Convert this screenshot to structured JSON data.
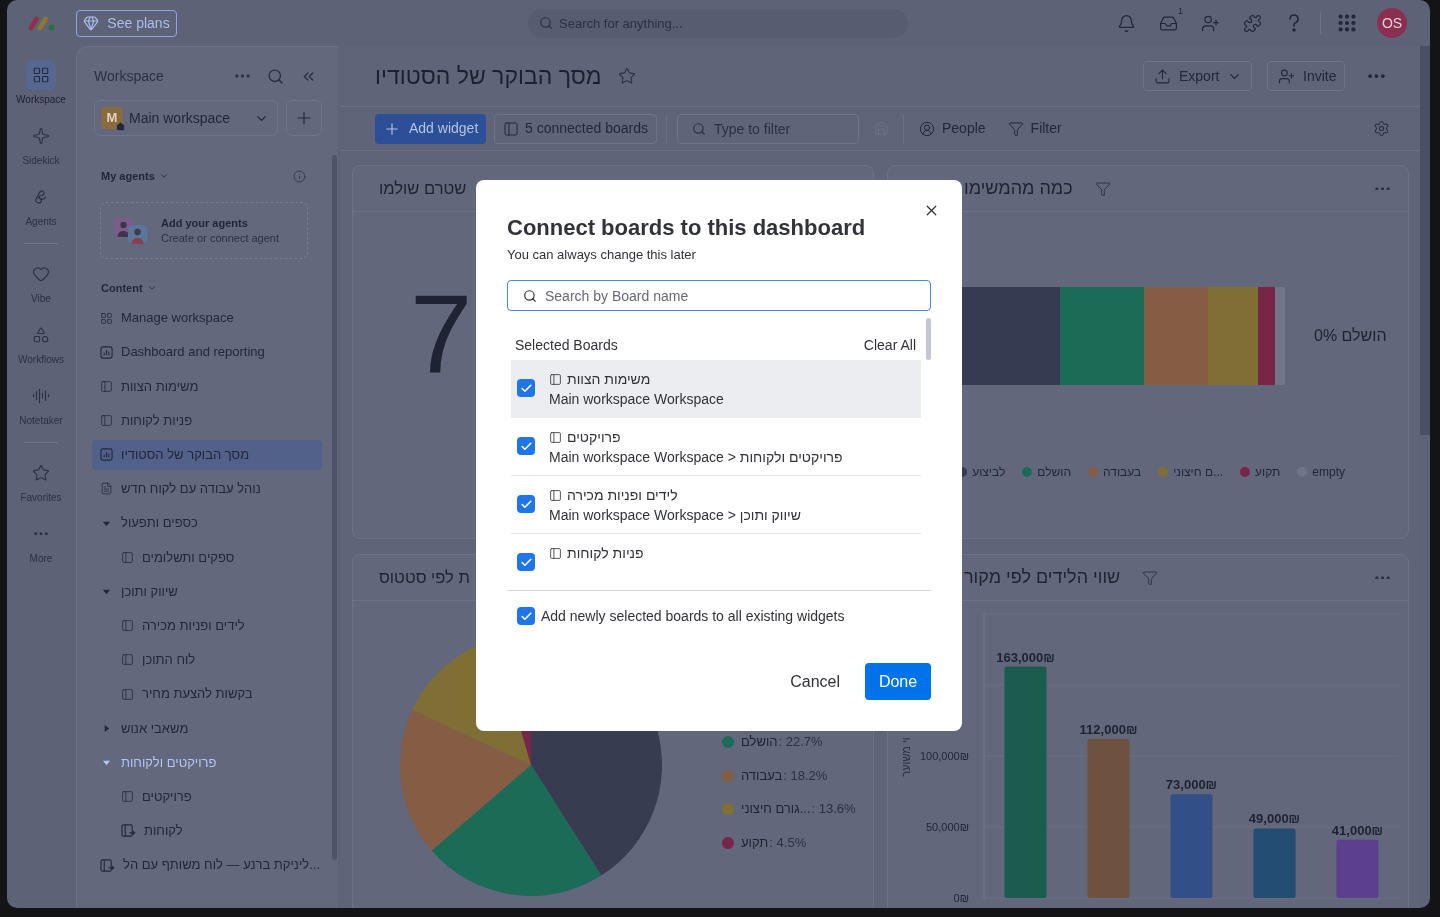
{
  "top_bar": {
    "upgrade": "See plans",
    "search": {
      "placeholder": "Search for anything..."
    },
    "inbox_badge": "1",
    "avatar": "OS"
  },
  "rail": {
    "groups": [
      {
        "items": [
          {
            "kind": "workspace",
            "label": "Workspace",
            "selected": true
          },
          {
            "kind": "sidekick",
            "label": "Sidekick",
            "selected": false
          },
          {
            "kind": "agents",
            "label": "Agents",
            "selected": false
          }
        ]
      },
      {
        "items": [
          {
            "kind": "vibe",
            "label": "Vibe",
            "selected": false
          },
          {
            "kind": "workflows",
            "label": "Workflows",
            "selected": false
          },
          {
            "kind": "notetaker",
            "label": "Notetaker",
            "selected": false
          }
        ]
      },
      {
        "items": [
          {
            "kind": "favorites",
            "label": "Favorites",
            "selected": false
          },
          {
            "kind": "more",
            "label": "More",
            "selected": false
          }
        ]
      }
    ]
  },
  "sidebar": {
    "title": "Workspace",
    "workspace": {
      "initial": "M",
      "name": "Main workspace"
    },
    "agents_heading": "My agents",
    "agent_card": {
      "title": "Add your agents",
      "subtitle": "Create or connect agent"
    },
    "content_heading": "Content",
    "items": [
      {
        "kind": "manage",
        "label": "Manage workspace",
        "selected": false
      },
      {
        "kind": "reports",
        "label": "Dashboard and reporting",
        "selected": false
      },
      {
        "kind": "board",
        "label": "משימות הצוות",
        "selected": false
      },
      {
        "kind": "board",
        "label": "פניות לקוחות",
        "selected": false
      },
      {
        "kind": "dashboard",
        "label": "מסך הבוקר של הסטודיו",
        "selected": true
      },
      {
        "kind": "doc",
        "label": "נוהל עבודה עם לקוח חדש",
        "selected": false
      },
      {
        "kind": "folder",
        "label": "כספים ותפעול",
        "selected": false,
        "expanded": true,
        "highlighted": false,
        "children": [
          {
            "kind": "board",
            "label": "ספקים ותשלומים",
            "selected": false
          }
        ]
      },
      {
        "kind": "folder",
        "label": "שיווק ותוכן",
        "selected": false,
        "expanded": true,
        "highlighted": false,
        "children": [
          {
            "kind": "board",
            "label": "לידים ופניות מכירה",
            "selected": false
          },
          {
            "kind": "board",
            "label": "לוח התוכן",
            "selected": false
          },
          {
            "kind": "board",
            "label": "בקשות להצעת מחיר",
            "selected": false
          }
        ]
      },
      {
        "kind": "folder",
        "label": "משאבי אנוש",
        "selected": false,
        "expanded": false,
        "highlighted": false
      },
      {
        "kind": "folder",
        "label": "פרויקטים ולקוחות",
        "selected": false,
        "expanded": true,
        "highlighted": true,
        "children": [
          {
            "kind": "board",
            "label": "פרויקטים",
            "selected": false
          },
          {
            "kind": "shared_board",
            "label": "לקוחות",
            "selected": false
          }
        ]
      },
      {
        "kind": "shared_board",
        "label": "ליניקת ברנע — לוח משותף עם הל...",
        "selected": false
      }
    ]
  },
  "dashboard": {
    "title": "מסך הבוקר של הסטודיו",
    "export": "Export",
    "invite": "Invite"
  },
  "toolbar": {
    "add_widget": "Add widget",
    "boards": "5 connected boards",
    "filter": {
      "placeholder": "Type to filter"
    },
    "people": "People",
    "filter_button": "Filter"
  },
  "widgets": [
    {
      "kind": "stacked_bar",
      "title": "כמה מהמשימו",
      "summary": "0% הושלם",
      "legend": [
        {
          "label": "empty",
          "color": "#70758a"
        },
        {
          "label": "תקוע",
          "color": "#782645"
        },
        {
          "label": "ם חיצוני...",
          "color": "#7f6f35"
        },
        {
          "label": "בעבודה",
          "color": "#855c44"
        },
        {
          "label": "הושלם",
          "color": "#1c6b57"
        },
        {
          "label": "לביצוע",
          "color": "#363b51"
        }
      ]
    },
    {
      "kind": "number",
      "title": "שטרם שולמו",
      "value": "7"
    },
    {
      "kind": "bar",
      "title": "שווי הלידים לפי מקור",
      "chart_data": {
        "type": "bar",
        "ylabel": "וי משוער",
        "values": [
          163000,
          112000,
          73000,
          49000,
          41000
        ],
        "value_labels": [
          "163,000₪",
          "112,000₪",
          "73,000₪",
          "49,000₪",
          "41,000₪"
        ],
        "colors": [
          "#1a5d4e",
          "#6f5140",
          "#334f88",
          "#234d73",
          "#5c3f8e"
        ],
        "ylim": [
          0,
          200000
        ],
        "yticks": [
          {
            "value": 0,
            "label": "0₪"
          },
          {
            "value": 50000,
            "label": "50,000₪"
          },
          {
            "value": 100000,
            "label": "100,000₪"
          }
        ]
      }
    },
    {
      "kind": "pie",
      "title": "ת לפי סטטוס",
      "legend": [
        {
          "label": "הושלם",
          "value": ": 22.7%",
          "color": "#1c6b57"
        },
        {
          "label": "בעבודה",
          "value": ": 18.2%",
          "color": "#855c44"
        },
        {
          "label": "גורם חיצוני...",
          "value": ": 13.6%",
          "color": "#7f6f35"
        },
        {
          "label": "תקוע",
          "value": ": 4.5%",
          "color": "#782645"
        }
      ]
    }
  ],
  "modal": {
    "title": "Connect boards to this dashboard",
    "subtitle": "You can always change this later",
    "search": {
      "placeholder": "Search by Board name"
    },
    "list_heading": "Selected Boards",
    "clear_all": "Clear All",
    "boards": [
      {
        "name": "משימות הצוות",
        "path": "Main workspace Workspace",
        "checked": true,
        "highlighted": true
      },
      {
        "name": "פרויקטים",
        "path": "Main workspace Workspace > פרויקטים ולקוחות",
        "checked": true,
        "highlighted": false
      },
      {
        "name": "לידים ופניות מכירה",
        "path": "Main workspace Workspace > שיווק ותוכן",
        "checked": true,
        "highlighted": false
      },
      {
        "name": "פניות לקוחות",
        "checked": true,
        "highlighted": false
      }
    ],
    "add_to_widgets": {
      "label": "Add newly selected boards to all existing widgets",
      "checked": true
    },
    "cancel": "Cancel",
    "done": "Done"
  }
}
